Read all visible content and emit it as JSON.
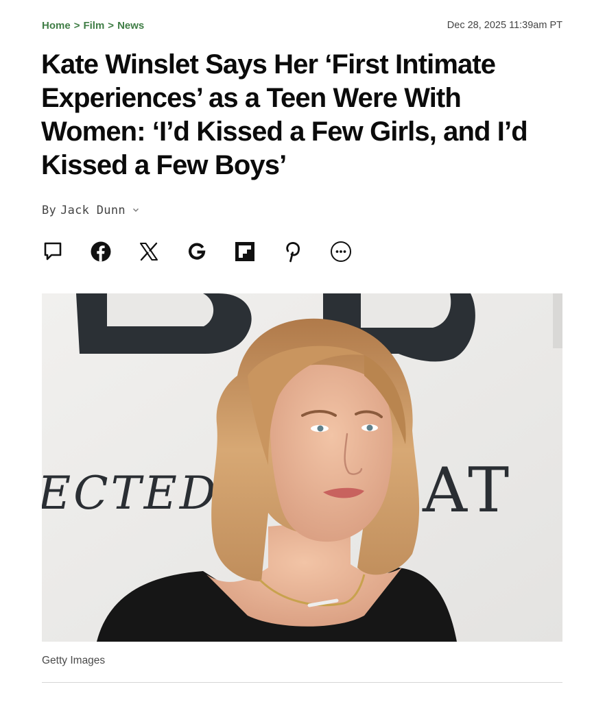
{
  "breadcrumb": {
    "items": [
      {
        "label": "Home"
      },
      {
        "label": "Film"
      },
      {
        "label": "News"
      }
    ],
    "separator": ">"
  },
  "article": {
    "date": "Dec 28, 2025 11:39am PT",
    "headline": "Kate Winslet Says Her ‘First Intimate Experiences’ as a Teen Were With Women: ‘I’d Kissed a Few Girls, and I’d Kissed a Few Boys’",
    "byline_prefix": "By",
    "author": "Jack Dunn",
    "image_credit": "Getty Images"
  },
  "hero_backdrop": {
    "letters_top": "DD",
    "words_left": "ECTED",
    "words_right": "AT"
  },
  "share": {
    "buttons": [
      {
        "icon": "comment-icon"
      },
      {
        "icon": "facebook-icon"
      },
      {
        "icon": "x-icon"
      },
      {
        "icon": "google-icon"
      },
      {
        "icon": "flipboard-icon"
      },
      {
        "icon": "pinterest-icon"
      },
      {
        "icon": "more-icon"
      }
    ]
  },
  "colors": {
    "breadcrumb": "#3f7d45",
    "headline": "#0b0b0b",
    "meta_text": "#444444"
  }
}
